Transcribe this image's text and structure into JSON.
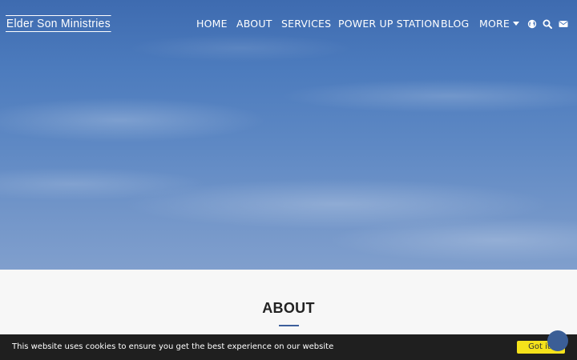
{
  "site": {
    "title": "Elder Son Ministries"
  },
  "nav": {
    "items": [
      {
        "label": "HOME"
      },
      {
        "label": "ABOUT"
      },
      {
        "label": "SERVICES"
      },
      {
        "label": "POWER UP STATION"
      },
      {
        "label": "BLOG"
      },
      {
        "label": "MORE"
      }
    ],
    "icons": [
      "globe-icon",
      "search-icon",
      "envelope-icon"
    ]
  },
  "about": {
    "title": "ABOUT"
  },
  "cookie": {
    "message": "This website uses cookies to ensure you get the best experience on our website",
    "button_label": "Got it!"
  },
  "colors": {
    "accent": "#3d5f9c",
    "cookie_bar": "#1f1f1f",
    "cookie_button": "#f5e21b"
  }
}
